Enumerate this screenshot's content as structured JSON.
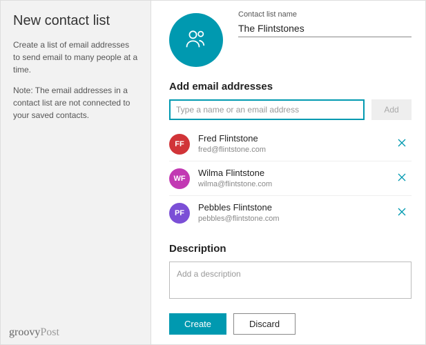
{
  "sidebar": {
    "title": "New contact list",
    "intro": "Create a list of email addresses to send email to many people at a time.",
    "note": "Note: The email addresses in a contact list are not connected to your saved contacts."
  },
  "watermark": {
    "a": "groovy",
    "b": "Post"
  },
  "nameField": {
    "label": "Contact list name",
    "value": "The Flintstones"
  },
  "emailSection": {
    "title": "Add email addresses",
    "placeholder": "Type a name or an email address",
    "addLabel": "Add"
  },
  "contacts": [
    {
      "initials": "FF",
      "name": "Fred Flintstone",
      "email": "fred@flintstone.com",
      "color": "#d13438"
    },
    {
      "initials": "WF",
      "name": "Wilma Flintstone",
      "email": "wilma@flintstone.com",
      "color": "#c239b3"
    },
    {
      "initials": "PF",
      "name": "Pebbles Flintstone",
      "email": "pebbles@flintstone.com",
      "color": "#7b4fd6"
    }
  ],
  "descriptionSection": {
    "title": "Description",
    "placeholder": "Add a description"
  },
  "footer": {
    "create": "Create",
    "discard": "Discard"
  }
}
